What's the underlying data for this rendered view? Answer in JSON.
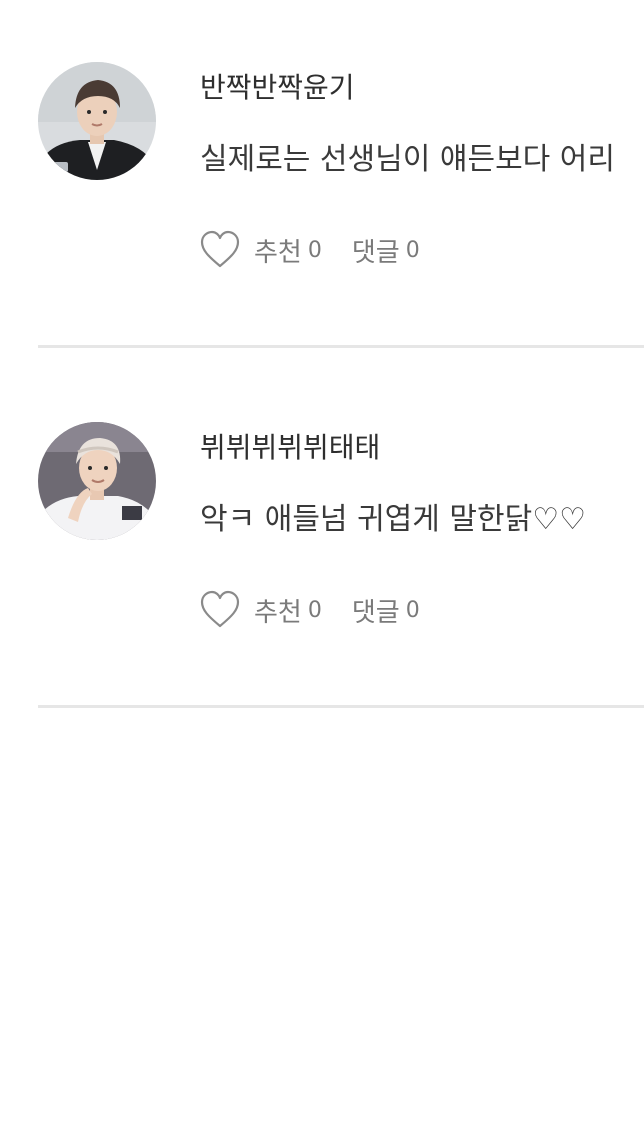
{
  "comments": [
    {
      "username": "반짝반짝윤기",
      "text": "실제로는 선생님이 얘든보다 어리",
      "like_label": "추천",
      "like_count": "0",
      "reply_label": "댓글",
      "reply_count": "0",
      "avatar_icon": "profile-photo"
    },
    {
      "username": "뷔뷔뷔뷔뷔태태",
      "text": "악ㅋ 애들넘 귀엽게 말한닭♡♡",
      "like_label": "추천",
      "like_count": "0",
      "reply_label": "댓글",
      "reply_count": "0",
      "avatar_icon": "profile-photo"
    }
  ],
  "colors": {
    "text": "#333333",
    "meta": "#7a7a7a",
    "divider": "#e6e6e6",
    "background": "#ffffff"
  }
}
